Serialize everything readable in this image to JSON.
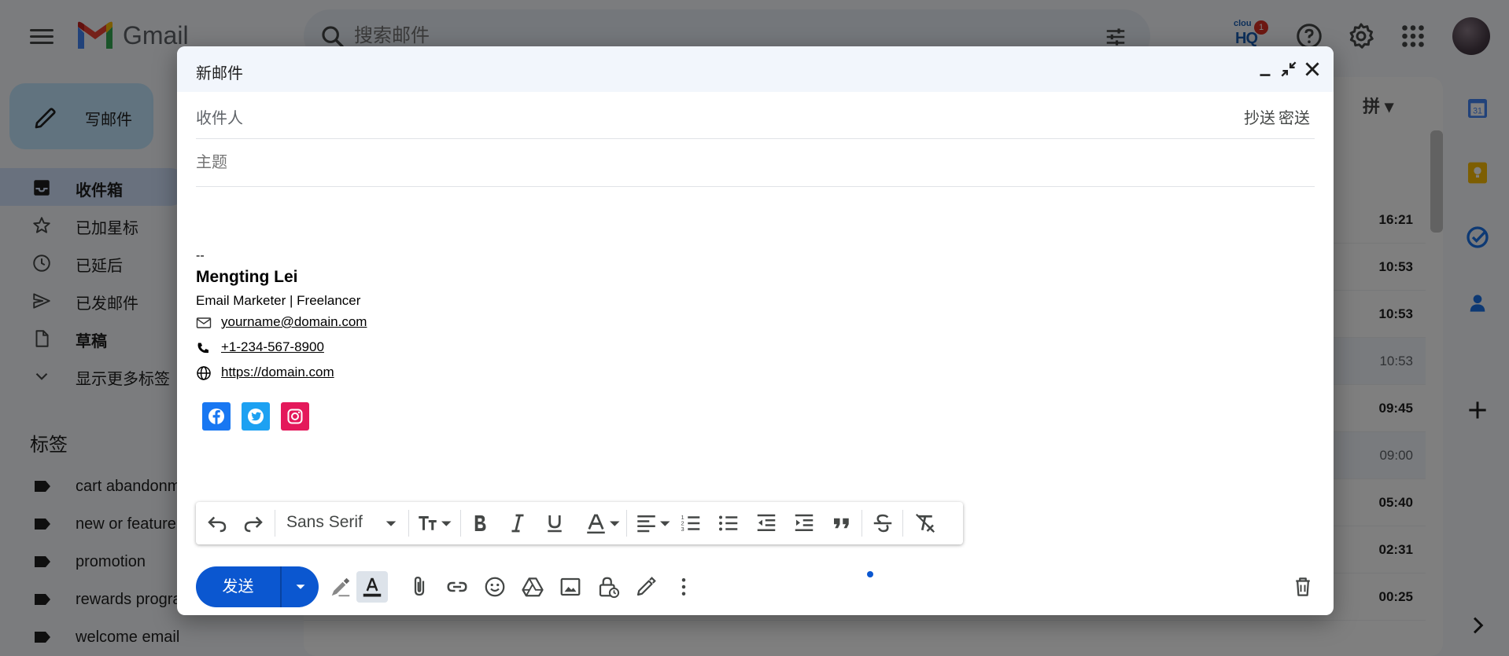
{
  "app": {
    "logo_text": "Gmail",
    "search_placeholder": "搜索邮件",
    "compose_label": "写邮件",
    "hq_top": "clou",
    "hq_text": "HQ",
    "hq_count": "1"
  },
  "nav": [
    {
      "label": "收件箱",
      "icon": "inbox-icon",
      "bold": true,
      "active": true
    },
    {
      "label": "已加星标",
      "icon": "star-icon",
      "bold": false,
      "active": false
    },
    {
      "label": "已延后",
      "icon": "clock-icon",
      "bold": false,
      "active": false
    },
    {
      "label": "已发邮件",
      "icon": "send-icon",
      "bold": false,
      "active": false
    },
    {
      "label": "草稿",
      "icon": "draft-icon",
      "bold": true,
      "active": false
    },
    {
      "label": "显示更多标签",
      "icon": "chevron-down-icon",
      "bold": false,
      "active": false
    }
  ],
  "labels_title": "标签",
  "labels": [
    "cart abandonment",
    "new or feature",
    "promotion",
    "rewards program",
    "welcome email"
  ],
  "pinyin": "拼",
  "mail_times": [
    {
      "time": "16:21",
      "style": "bold"
    },
    {
      "time": "10:53",
      "style": "bold"
    },
    {
      "time": "10:53",
      "style": "bold"
    },
    {
      "time": "10:53",
      "style": "light"
    },
    {
      "time": "09:45",
      "style": "bold"
    },
    {
      "time": "09:00",
      "style": "light"
    },
    {
      "time": "05:40",
      "style": "bold"
    },
    {
      "time": "02:31",
      "style": "bold"
    },
    {
      "time": "00:25",
      "style": "bold"
    }
  ],
  "compose": {
    "title": "新邮件",
    "to_label": "收件人",
    "cc_label": "抄送",
    "bcc_label": "密送",
    "subject_placeholder": "主题",
    "signature": {
      "dash": "--",
      "name": "Mengting Lei",
      "role": "Email Marketer | Freelancer",
      "email": "yourname@domain.com",
      "phone": "+1-234-567-8900",
      "website": "https://domain.com"
    },
    "social": [
      {
        "name": "facebook-icon",
        "color": "#1877f2"
      },
      {
        "name": "twitter-icon",
        "color": "#1da1f2"
      },
      {
        "name": "instagram-icon",
        "color": "#e4195b"
      }
    ],
    "font_name": "Sans Serif",
    "send_label": "发送"
  },
  "colors": {
    "send": "#0b57d0",
    "compose_button": "#c2e7ff",
    "active_nav": "#d3e3fd"
  }
}
